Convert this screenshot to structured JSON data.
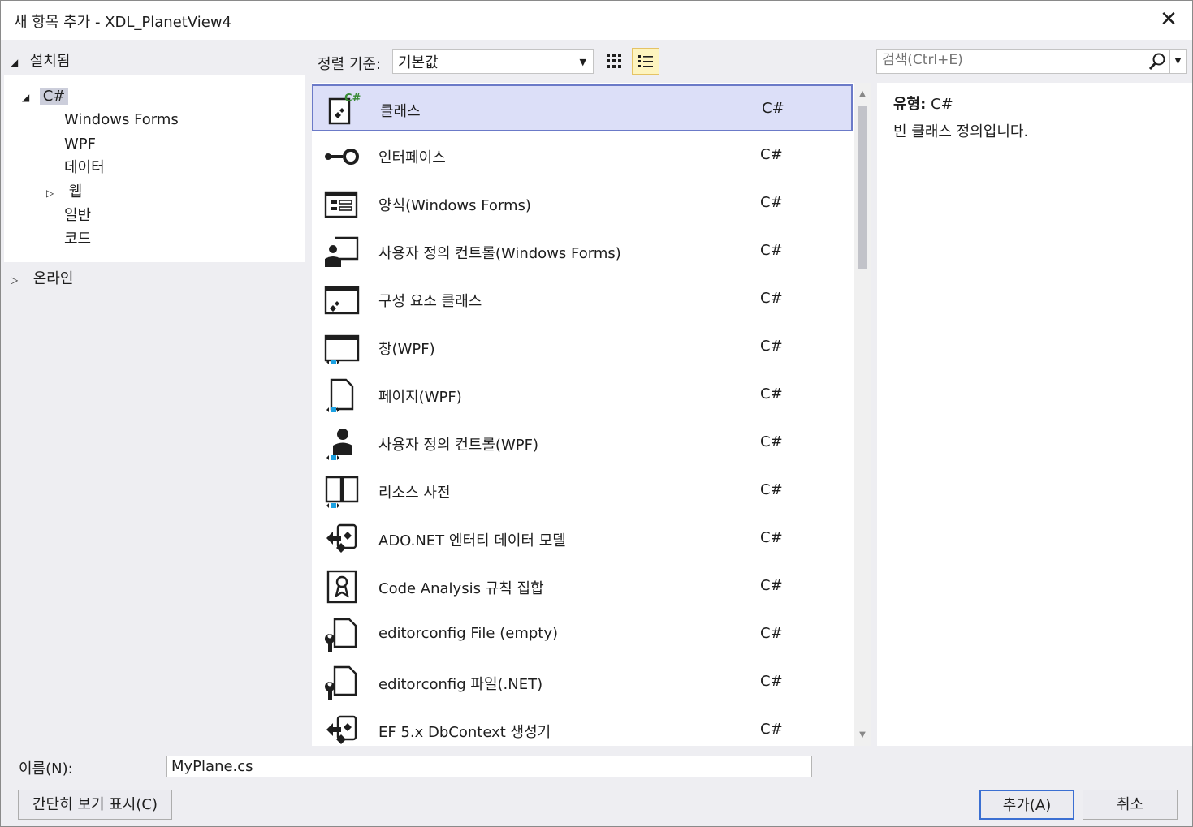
{
  "window": {
    "title": "새 항목 추가 - XDL_PlanetView4"
  },
  "left": {
    "installed_label": "설치됨",
    "tree": [
      {
        "label": "C#"
      },
      {
        "label": "Windows Forms"
      },
      {
        "label": "WPF"
      },
      {
        "label": "데이터"
      },
      {
        "label": "웹"
      },
      {
        "label": "일반"
      },
      {
        "label": "코드"
      }
    ],
    "online_label": "온라인"
  },
  "toolbar": {
    "sort_label": "정렬 기준:",
    "sort_value": "기본값",
    "search_placeholder": "검색(Ctrl+E)"
  },
  "items": [
    {
      "name": "클래스",
      "lang": "C#",
      "icon": "class-icon"
    },
    {
      "name": "인터페이스",
      "lang": "C#",
      "icon": "interface-icon"
    },
    {
      "name": "양식(Windows Forms)",
      "lang": "C#",
      "icon": "windows-form-icon"
    },
    {
      "name": "사용자 정의 컨트롤(Windows Forms)",
      "lang": "C#",
      "icon": "user-control-icon"
    },
    {
      "name": "구성 요소 클래스",
      "lang": "C#",
      "icon": "component-class-icon"
    },
    {
      "name": "창(WPF)",
      "lang": "C#",
      "icon": "wpf-window-icon"
    },
    {
      "name": "페이지(WPF)",
      "lang": "C#",
      "icon": "wpf-page-icon"
    },
    {
      "name": "사용자 정의 컨트롤(WPF)",
      "lang": "C#",
      "icon": "wpf-user-control-icon"
    },
    {
      "name": "리소스 사전",
      "lang": "C#",
      "icon": "resource-dictionary-icon"
    },
    {
      "name": "ADO.NET 엔터티 데이터 모델",
      "lang": "C#",
      "icon": "entity-model-icon"
    },
    {
      "name": "Code Analysis 규칙 집합",
      "lang": "C#",
      "icon": "ruleset-icon"
    },
    {
      "name": "editorconfig File (empty)",
      "lang": "C#",
      "icon": "editorconfig-icon"
    },
    {
      "name": "editorconfig 파일(.NET)",
      "lang": "C#",
      "icon": "editorconfig-icon"
    },
    {
      "name": "EF 5.x DbContext 생성기",
      "lang": "C#",
      "icon": "dbcontext-generator-icon"
    }
  ],
  "details": {
    "type_label": "유형:",
    "type_value": "C#",
    "description": "빈 클래스 정의입니다."
  },
  "bottom": {
    "name_label": "이름(N):",
    "name_value": "MyPlane.cs",
    "compact_view_label": "간단히 보기 표시(C)",
    "add_label": "추가(A)",
    "cancel_label": "취소"
  },
  "colors": {
    "selection_bg": "#dcdff8",
    "selection_border": "#6b7ac8",
    "accent_green": "#388a34",
    "accent_blue": "#1ba1e2"
  }
}
